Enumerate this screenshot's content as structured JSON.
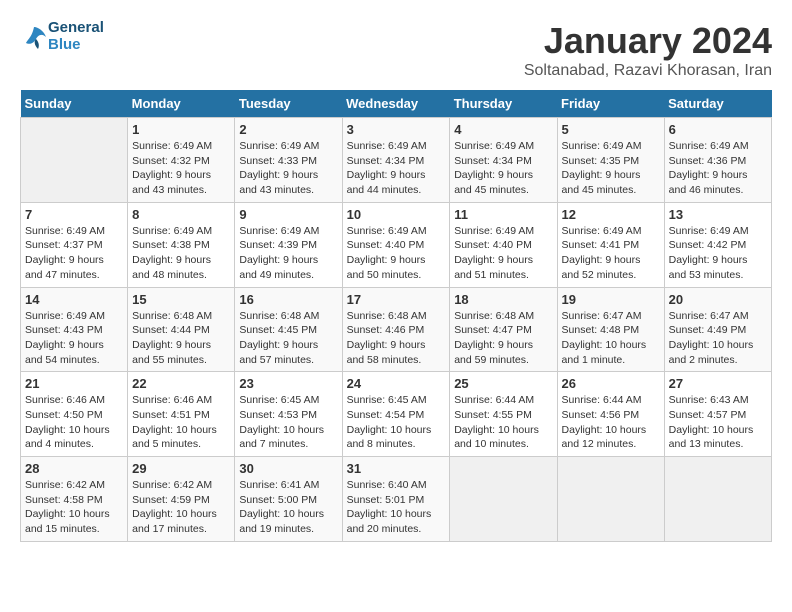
{
  "header": {
    "logo_line1": "General",
    "logo_line2": "Blue",
    "title": "January 2024",
    "subtitle": "Soltanabad, Razavi Khorasan, Iran"
  },
  "weekdays": [
    "Sunday",
    "Monday",
    "Tuesday",
    "Wednesday",
    "Thursday",
    "Friday",
    "Saturday"
  ],
  "weeks": [
    [
      {
        "day": "",
        "info": ""
      },
      {
        "day": "1",
        "info": "Sunrise: 6:49 AM\nSunset: 4:32 PM\nDaylight: 9 hours\nand 43 minutes."
      },
      {
        "day": "2",
        "info": "Sunrise: 6:49 AM\nSunset: 4:33 PM\nDaylight: 9 hours\nand 43 minutes."
      },
      {
        "day": "3",
        "info": "Sunrise: 6:49 AM\nSunset: 4:34 PM\nDaylight: 9 hours\nand 44 minutes."
      },
      {
        "day": "4",
        "info": "Sunrise: 6:49 AM\nSunset: 4:34 PM\nDaylight: 9 hours\nand 45 minutes."
      },
      {
        "day": "5",
        "info": "Sunrise: 6:49 AM\nSunset: 4:35 PM\nDaylight: 9 hours\nand 45 minutes."
      },
      {
        "day": "6",
        "info": "Sunrise: 6:49 AM\nSunset: 4:36 PM\nDaylight: 9 hours\nand 46 minutes."
      }
    ],
    [
      {
        "day": "7",
        "info": "Sunrise: 6:49 AM\nSunset: 4:37 PM\nDaylight: 9 hours\nand 47 minutes."
      },
      {
        "day": "8",
        "info": "Sunrise: 6:49 AM\nSunset: 4:38 PM\nDaylight: 9 hours\nand 48 minutes."
      },
      {
        "day": "9",
        "info": "Sunrise: 6:49 AM\nSunset: 4:39 PM\nDaylight: 9 hours\nand 49 minutes."
      },
      {
        "day": "10",
        "info": "Sunrise: 6:49 AM\nSunset: 4:40 PM\nDaylight: 9 hours\nand 50 minutes."
      },
      {
        "day": "11",
        "info": "Sunrise: 6:49 AM\nSunset: 4:40 PM\nDaylight: 9 hours\nand 51 minutes."
      },
      {
        "day": "12",
        "info": "Sunrise: 6:49 AM\nSunset: 4:41 PM\nDaylight: 9 hours\nand 52 minutes."
      },
      {
        "day": "13",
        "info": "Sunrise: 6:49 AM\nSunset: 4:42 PM\nDaylight: 9 hours\nand 53 minutes."
      }
    ],
    [
      {
        "day": "14",
        "info": "Sunrise: 6:49 AM\nSunset: 4:43 PM\nDaylight: 9 hours\nand 54 minutes."
      },
      {
        "day": "15",
        "info": "Sunrise: 6:48 AM\nSunset: 4:44 PM\nDaylight: 9 hours\nand 55 minutes."
      },
      {
        "day": "16",
        "info": "Sunrise: 6:48 AM\nSunset: 4:45 PM\nDaylight: 9 hours\nand 57 minutes."
      },
      {
        "day": "17",
        "info": "Sunrise: 6:48 AM\nSunset: 4:46 PM\nDaylight: 9 hours\nand 58 minutes."
      },
      {
        "day": "18",
        "info": "Sunrise: 6:48 AM\nSunset: 4:47 PM\nDaylight: 9 hours\nand 59 minutes."
      },
      {
        "day": "19",
        "info": "Sunrise: 6:47 AM\nSunset: 4:48 PM\nDaylight: 10 hours\nand 1 minute."
      },
      {
        "day": "20",
        "info": "Sunrise: 6:47 AM\nSunset: 4:49 PM\nDaylight: 10 hours\nand 2 minutes."
      }
    ],
    [
      {
        "day": "21",
        "info": "Sunrise: 6:46 AM\nSunset: 4:50 PM\nDaylight: 10 hours\nand 4 minutes."
      },
      {
        "day": "22",
        "info": "Sunrise: 6:46 AM\nSunset: 4:51 PM\nDaylight: 10 hours\nand 5 minutes."
      },
      {
        "day": "23",
        "info": "Sunrise: 6:45 AM\nSunset: 4:53 PM\nDaylight: 10 hours\nand 7 minutes."
      },
      {
        "day": "24",
        "info": "Sunrise: 6:45 AM\nSunset: 4:54 PM\nDaylight: 10 hours\nand 8 minutes."
      },
      {
        "day": "25",
        "info": "Sunrise: 6:44 AM\nSunset: 4:55 PM\nDaylight: 10 hours\nand 10 minutes."
      },
      {
        "day": "26",
        "info": "Sunrise: 6:44 AM\nSunset: 4:56 PM\nDaylight: 10 hours\nand 12 minutes."
      },
      {
        "day": "27",
        "info": "Sunrise: 6:43 AM\nSunset: 4:57 PM\nDaylight: 10 hours\nand 13 minutes."
      }
    ],
    [
      {
        "day": "28",
        "info": "Sunrise: 6:42 AM\nSunset: 4:58 PM\nDaylight: 10 hours\nand 15 minutes."
      },
      {
        "day": "29",
        "info": "Sunrise: 6:42 AM\nSunset: 4:59 PM\nDaylight: 10 hours\nand 17 minutes."
      },
      {
        "day": "30",
        "info": "Sunrise: 6:41 AM\nSunset: 5:00 PM\nDaylight: 10 hours\nand 19 minutes."
      },
      {
        "day": "31",
        "info": "Sunrise: 6:40 AM\nSunset: 5:01 PM\nDaylight: 10 hours\nand 20 minutes."
      },
      {
        "day": "",
        "info": ""
      },
      {
        "day": "",
        "info": ""
      },
      {
        "day": "",
        "info": ""
      }
    ]
  ]
}
